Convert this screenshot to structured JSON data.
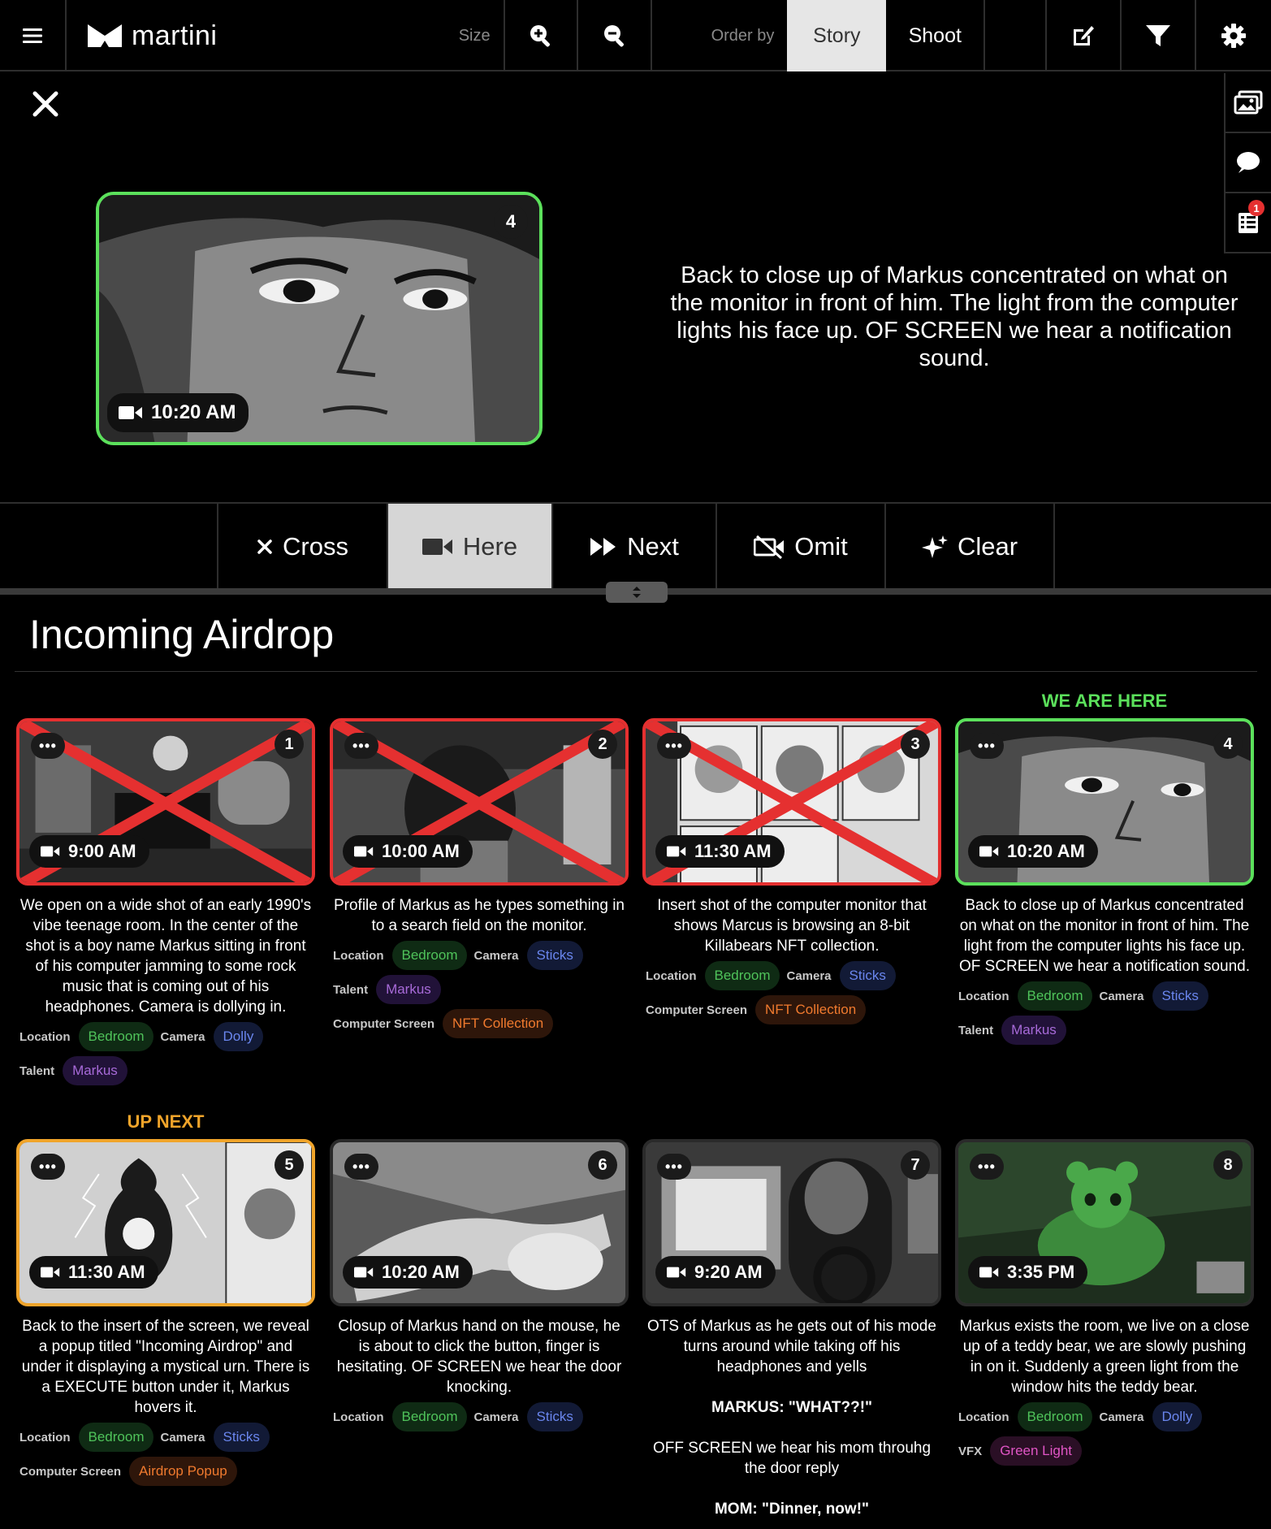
{
  "topbar": {
    "brand": "martini",
    "size_label": "Size",
    "order_label": "Order by",
    "tabs": [
      {
        "label": "Story",
        "active": true
      },
      {
        "label": "Shoot",
        "active": false
      }
    ],
    "accent": "#5be05b"
  },
  "rail": {
    "notification_count": "1"
  },
  "preview": {
    "time": "10:20 AM",
    "number": "4",
    "description": "Back to close up of Markus concentrated on what on the monitor in front of him. The light from the computer lights his face up. OF SCREEN we hear a notification sound."
  },
  "actions": [
    {
      "label": "Cross",
      "icon": "x-icon",
      "active": false
    },
    {
      "label": "Here",
      "icon": "video-camera-icon",
      "active": true
    },
    {
      "label": "Next",
      "icon": "fast-forward-icon",
      "active": false
    },
    {
      "label": "Omit",
      "icon": "video-off-icon",
      "active": false
    },
    {
      "label": "Clear",
      "icon": "sparkle-icon",
      "active": false
    }
  ],
  "list": {
    "title": "Incoming Airdrop",
    "marker_here": "WE ARE HERE",
    "marker_next": "UP NEXT",
    "cards": [
      {
        "number": "1",
        "time": "9:00 AM",
        "state": "crossed",
        "description": "We open on a wide shot of an early 1990's vibe teenage room. In the center of the shot is a boy name Markus sitting in front of his computer jamming to some rock music that is coming out of his headphones. Camera is dollying in.",
        "tag_rows": [
          [
            {
              "label": "Location",
              "value": "Bedroom",
              "color": "green"
            },
            {
              "label": "Camera",
              "value": "Dolly",
              "color": "blue"
            }
          ],
          [
            {
              "label": "Talent",
              "value": "Markus",
              "color": "purple"
            }
          ]
        ]
      },
      {
        "number": "2",
        "time": "10:00 AM",
        "state": "crossed",
        "description": "Profile of Markus as he types something in to a search field on the monitor.",
        "tag_rows": [
          [
            {
              "label": "Location",
              "value": "Bedroom",
              "color": "green"
            },
            {
              "label": "Camera",
              "value": "Sticks",
              "color": "blue"
            }
          ],
          [
            {
              "label": "Talent",
              "value": "Markus",
              "color": "purple"
            }
          ],
          [
            {
              "label": "Computer Screen",
              "value": "NFT Collection",
              "color": "orange"
            }
          ]
        ]
      },
      {
        "number": "3",
        "time": "11:30 AM",
        "state": "crossed",
        "description": "Insert shot of the computer monitor that shows Marcus is browsing an 8-bit Killabears NFT collection.",
        "tag_rows": [
          [
            {
              "label": "Location",
              "value": "Bedroom",
              "color": "green"
            },
            {
              "label": "Camera",
              "value": "Sticks",
              "color": "blue"
            }
          ],
          [
            {
              "label": "Computer Screen",
              "value": "NFT Collection",
              "color": "orange"
            }
          ]
        ]
      },
      {
        "number": "4",
        "time": "10:20 AM",
        "state": "here",
        "description": "Back to close up of Markus concentrated on what on the monitor in front of him. The light from the computer lights his face up. OF SCREEN we hear a notification sound.",
        "tag_rows": [
          [
            {
              "label": "Location",
              "value": "Bedroom",
              "color": "green"
            },
            {
              "label": "Camera",
              "value": "Sticks",
              "color": "blue"
            }
          ],
          [
            {
              "label": "Talent",
              "value": "Markus",
              "color": "purple"
            }
          ]
        ]
      },
      {
        "number": "5",
        "time": "11:30 AM",
        "state": "next",
        "description": "Back to the insert of the screen, we reveal a popup titled \"Incoming Airdrop\" and under it displaying a mystical urn. There is a EXECUTE button under it, Markus hovers it.",
        "tag_rows": [
          [
            {
              "label": "Location",
              "value": "Bedroom",
              "color": "green"
            },
            {
              "label": "Camera",
              "value": "Sticks",
              "color": "blue"
            }
          ],
          [
            {
              "label": "Computer Screen",
              "value": "Airdrop Popup",
              "color": "orange"
            }
          ]
        ]
      },
      {
        "number": "6",
        "time": "10:20 AM",
        "state": "normal",
        "description": "Closup of Markus hand on the mouse, he is about to click the button, finger is hesitating. OF SCREEN we hear the door knocking.",
        "tag_rows": [
          [
            {
              "label": "Location",
              "value": "Bedroom",
              "color": "green"
            },
            {
              "label": "Camera",
              "value": "Sticks",
              "color": "blue"
            }
          ]
        ]
      },
      {
        "number": "7",
        "time": "9:20 AM",
        "state": "normal",
        "description": "OTS of Markus as he gets out of his mode turns around while taking off his headphones and yells",
        "dialogue": [
          "MARKUS: \"WHAT??!\"",
          "OFF SCREEN we hear his mom throuhg the door reply",
          "MOM: \"Dinner, now!\""
        ],
        "tag_rows": []
      },
      {
        "number": "8",
        "time": "3:35 PM",
        "state": "normal",
        "description": "Markus exists the room, we live on a close up of a teddy bear, we are slowly pushing in on it. Suddenly a green light from the window hits the teddy bear.",
        "tag_rows": [
          [
            {
              "label": "Location",
              "value": "Bedroom",
              "color": "green"
            },
            {
              "label": "Camera",
              "value": "Dolly",
              "color": "blue"
            }
          ],
          [
            {
              "label": "VFX",
              "value": "Green Light",
              "color": "magenta"
            }
          ]
        ]
      }
    ]
  }
}
